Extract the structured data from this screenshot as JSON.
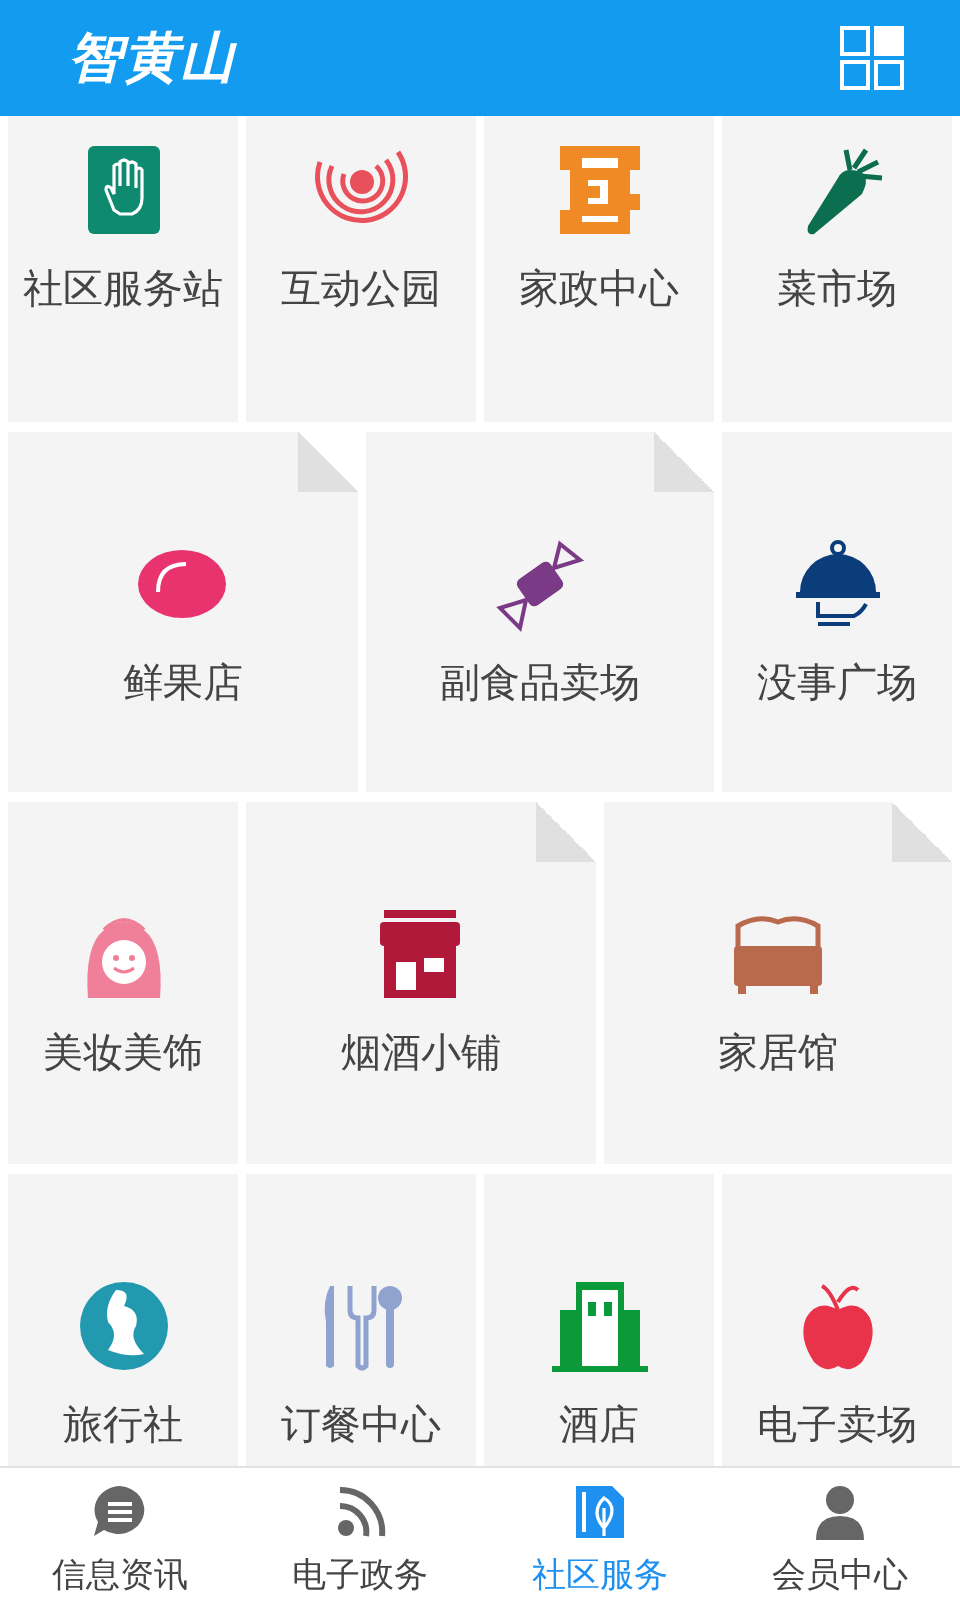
{
  "header": {
    "logo": "智黄山"
  },
  "rows": [
    {
      "tiles": [
        {
          "label": "社区服务站",
          "folded": false
        },
        {
          "label": "互动公园",
          "folded": false
        },
        {
          "label": "家政中心",
          "folded": false
        },
        {
          "label": "菜市场",
          "folded": false
        }
      ]
    },
    {
      "tiles": [
        {
          "label": "鲜果店",
          "folded": true
        },
        {
          "label": "副食品卖场",
          "folded": true
        },
        {
          "label": "没事广场",
          "folded": false
        }
      ]
    },
    {
      "tiles": [
        {
          "label": "美妆美饰",
          "folded": false
        },
        {
          "label": "烟酒小铺",
          "folded": true
        },
        {
          "label": "家居馆",
          "folded": true
        }
      ]
    },
    {
      "tiles": [
        {
          "label": "旅行社",
          "folded": false
        },
        {
          "label": "订餐中心",
          "folded": false
        },
        {
          "label": "酒店",
          "folded": false
        },
        {
          "label": "电子卖场",
          "folded": false
        }
      ]
    }
  ],
  "tabs": [
    {
      "label": "信息资讯",
      "selected": false
    },
    {
      "label": "电子政务",
      "selected": false
    },
    {
      "label": "社区服务",
      "selected": true
    },
    {
      "label": "会员中心",
      "selected": false
    }
  ]
}
